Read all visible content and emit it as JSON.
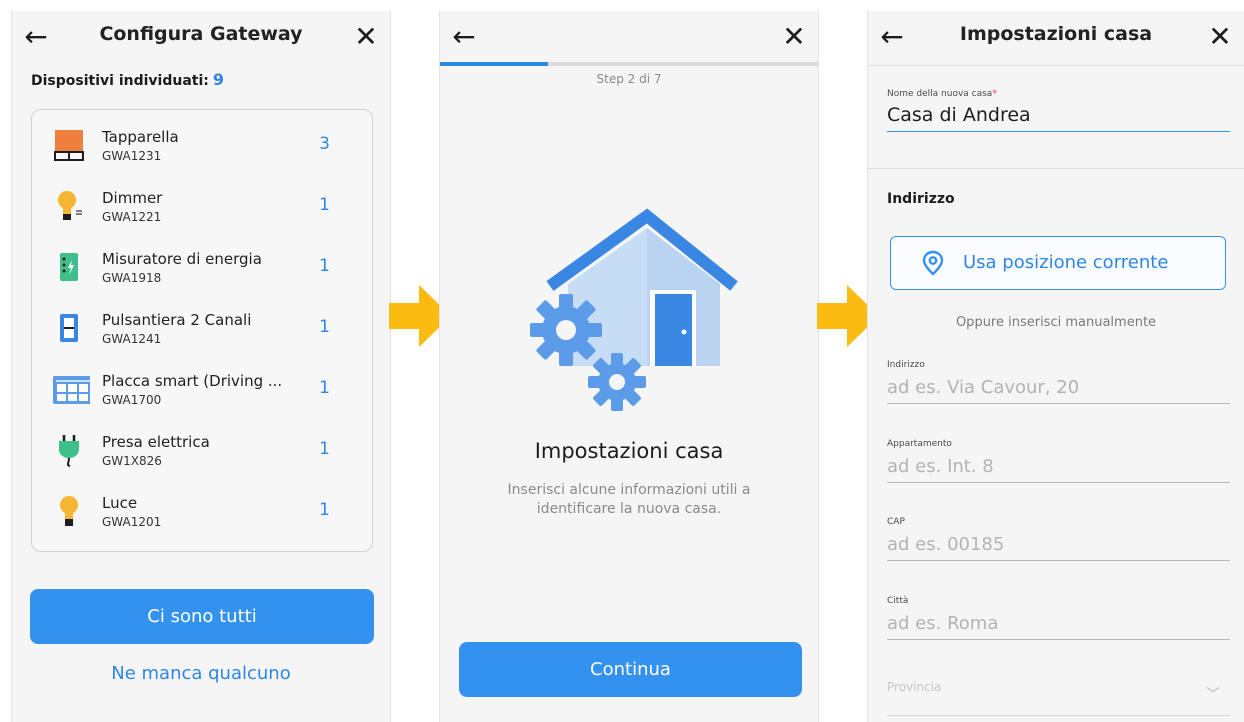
{
  "screen1": {
    "title": "Configura Gateway",
    "found_label": "Dispositivi individuati:",
    "found_count": "9",
    "devices": [
      {
        "name": "Tapparella",
        "code": "GWA1231",
        "count": "3",
        "icon": "shutter-icon"
      },
      {
        "name": "Dimmer",
        "code": "GWA1221",
        "count": "1",
        "icon": "dimmer-bulb-icon"
      },
      {
        "name": "Misuratore di energia",
        "code": "GWA1918",
        "count": "1",
        "icon": "energy-meter-icon"
      },
      {
        "name": "Pulsantiera 2 Canali",
        "code": "GWA1241",
        "count": "1",
        "icon": "switch-panel-icon"
      },
      {
        "name": "Placca smart (Driving ...",
        "code": "GWA1700",
        "count": "1",
        "icon": "smart-plate-icon"
      },
      {
        "name": "Presa elettrica",
        "code": "GW1X826",
        "count": "1",
        "icon": "plug-icon"
      },
      {
        "name": "Luce",
        "code": "GWA1201",
        "count": "1",
        "icon": "bulb-icon"
      }
    ],
    "primary_button": "Ci sono tutti",
    "secondary_link": "Ne manca qualcuno"
  },
  "screen2": {
    "step": "Step 2 di 7",
    "progress": 0.286,
    "title": "Impostazioni casa",
    "subtitle": "Inserisci alcune informazioni utili a identificare la nuova casa.",
    "button": "Continua"
  },
  "screen3": {
    "title": "Impostazioni casa",
    "name_label": "Nome della nuova casa",
    "name_required_mark": "*",
    "name_value": "Casa di Andrea",
    "section_title": "Indirizzo",
    "location_button": "Usa posizione corrente",
    "or_text": "Oppure inserisci manualmente",
    "fields": [
      {
        "label": "Indirizzo",
        "placeholder": "ad es. Via Cavour, 20"
      },
      {
        "label": "Appartamento",
        "placeholder": "ad es. Int. 8"
      },
      {
        "label": "CAP",
        "placeholder": "ad es. 00185"
      },
      {
        "label": "Città",
        "placeholder": "ad es. Roma"
      }
    ],
    "province_label": "Provincia"
  },
  "colors": {
    "accent": "#3392f0",
    "arrow": "#fbbb10",
    "background": "#f5f5f5"
  }
}
